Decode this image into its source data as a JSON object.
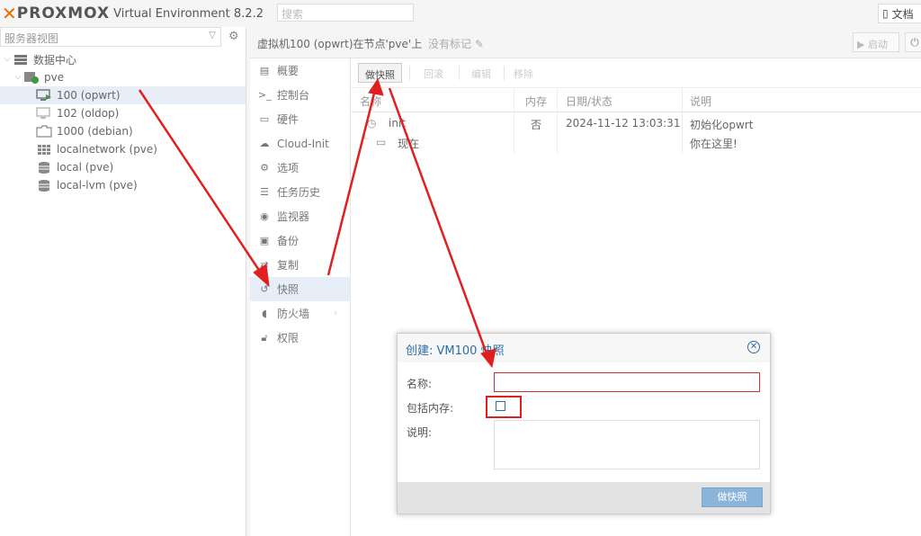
{
  "header": {
    "brand": "PROXMOX",
    "version": "Virtual Environment 8.2.2",
    "search_placeholder": "搜索",
    "docs": "文档"
  },
  "tree": {
    "view_select": "服务器视图",
    "nodes": [
      {
        "label": "数据中心"
      },
      {
        "label": "pve"
      },
      {
        "label": "100 (opwrt)"
      },
      {
        "label": "102 (oldop)"
      },
      {
        "label": "1000 (debian)"
      },
      {
        "label": "localnetwork (pve)"
      },
      {
        "label": "local (pve)"
      },
      {
        "label": "local-lvm (pve)"
      }
    ]
  },
  "main": {
    "title": "虚拟机100 (opwrt)在节点'pve'上",
    "no_tags": "没有标记",
    "start_button": "启动"
  },
  "menu": {
    "items": [
      {
        "label": "概要"
      },
      {
        "label": "控制台"
      },
      {
        "label": "硬件"
      },
      {
        "label": "Cloud-Init"
      },
      {
        "label": "选项"
      },
      {
        "label": "任务历史"
      },
      {
        "label": "监视器"
      },
      {
        "label": "备份"
      },
      {
        "label": "复制"
      },
      {
        "label": "快照"
      },
      {
        "label": "防火墙"
      },
      {
        "label": "权限"
      }
    ]
  },
  "toolbar": {
    "snapshot": "做快照",
    "rollback": "回滚",
    "edit": "编辑",
    "remove": "移除"
  },
  "table": {
    "headers": [
      "名称",
      "内存",
      "日期/状态",
      "说明"
    ],
    "rows": [
      {
        "name": "init",
        "memory": "否",
        "date": "2024-11-12 13:03:31",
        "desc": "初始化opwrt"
      },
      {
        "name": "现在",
        "memory": "",
        "date": "",
        "desc": "你在这里!"
      }
    ]
  },
  "dialog": {
    "title": "创建: VM100 快照",
    "name_label": "名称:",
    "include_ram_label": "包括内存:",
    "desc_label": "说明:",
    "submit": "做快照"
  },
  "colors": {
    "accent": "#2b6ea8",
    "annotation": "#e02020",
    "brand_orange": "#e57000"
  }
}
